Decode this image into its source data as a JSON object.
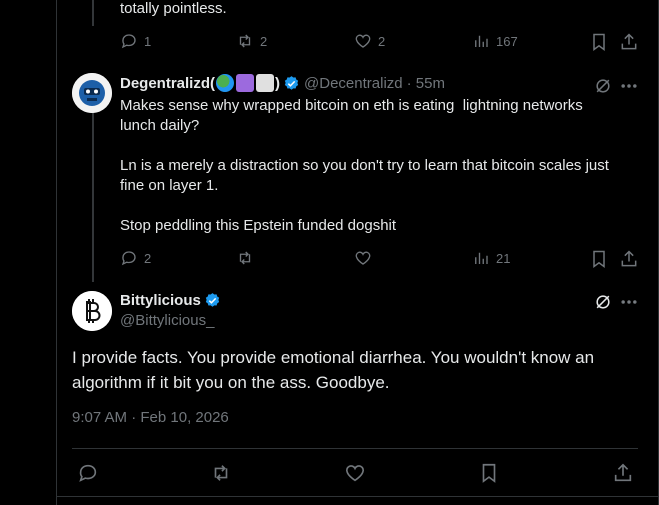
{
  "prev_tweet": {
    "tail_text": "totally pointless.",
    "replies": "1",
    "retweets": "2",
    "likes": "2",
    "views": "167"
  },
  "reply_tweet": {
    "display_name": "Degentralizd(",
    "display_name_suffix": ")",
    "emojis": [
      "globe-emoji",
      "peace-emoji",
      "skull-crossbones-emoji"
    ],
    "handle": "@Decentralizd",
    "time": "· 55m",
    "body": [
      "Makes sense why wrapped bitcoin on eth is eating  lightning networks lunch daily?",
      "Ln is a merely a distraction so you don't try to learn that bitcoin scales just fine on layer 1.",
      "Stop peddling this Epstein funded dogshit"
    ],
    "replies": "2",
    "retweets": "",
    "likes": "",
    "views": "21"
  },
  "main_tweet": {
    "display_name": "Bittylicious",
    "handle": "@Bittylicious_",
    "avatar_letter": "B",
    "text": "I provide facts. You provide emotional diarrhea. You wouldn't know an algorithm if it bit you on the ass. Goodbye.",
    "timestamp": "9:07 AM · Feb 10, 2026"
  },
  "colors": {
    "background": "#000000",
    "text": "#e7e9ea",
    "muted": "#71767b",
    "border": "#2f3336",
    "verified": "#1d9bf0"
  }
}
